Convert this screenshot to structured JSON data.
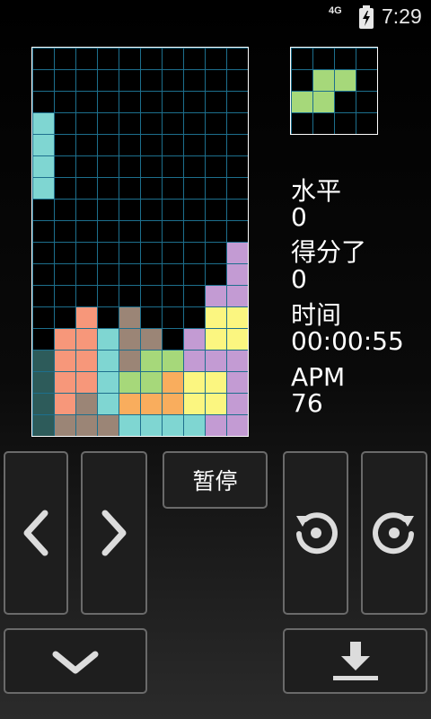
{
  "status_bar": {
    "network": "4G",
    "time": "7:29"
  },
  "stats": {
    "level_label": "水平",
    "level_value": "0",
    "score_label": "得分了",
    "score_value": "0",
    "time_label": "时间",
    "time_value": "00:00:55",
    "apm_label": "APM",
    "apm_value": "76"
  },
  "controls": {
    "pause_label": "暂停",
    "left_icon": "chevron-left-icon",
    "right_icon": "chevron-right-icon",
    "rotate_ccw_icon": "rotate-ccw-icon",
    "rotate_cw_icon": "rotate-cw-icon",
    "soft_drop_icon": "chevron-down-icon",
    "hard_drop_icon": "hard-drop-icon"
  },
  "colors": {
    "grid_line": "#1d6f8d",
    "cyan": "#7fd6d2",
    "dark_teal": "#2d5b5a",
    "salmon": "#f7977a",
    "brown": "#9b8576",
    "green": "#a6d87a",
    "orange": "#f9ad5d",
    "yellow": "#fbf680",
    "purple": "#c39bd3"
  },
  "board": {
    "columns": 10,
    "rows": 18,
    "cells": [
      [
        0,
        3,
        "cyan"
      ],
      [
        0,
        4,
        "cyan"
      ],
      [
        0,
        5,
        "cyan"
      ],
      [
        0,
        6,
        "cyan"
      ],
      [
        9,
        9,
        "purple"
      ],
      [
        9,
        10,
        "purple"
      ],
      [
        8,
        11,
        "purple"
      ],
      [
        9,
        11,
        "purple"
      ],
      [
        2,
        12,
        "salmon"
      ],
      [
        4,
        12,
        "brown"
      ],
      [
        8,
        12,
        "yellow"
      ],
      [
        9,
        12,
        "yellow"
      ],
      [
        1,
        13,
        "salmon"
      ],
      [
        2,
        13,
        "salmon"
      ],
      [
        3,
        13,
        "cyan"
      ],
      [
        4,
        13,
        "brown"
      ],
      [
        5,
        13,
        "brown"
      ],
      [
        7,
        13,
        "purple"
      ],
      [
        8,
        13,
        "yellow"
      ],
      [
        9,
        13,
        "yellow"
      ],
      [
        0,
        14,
        "dark_teal"
      ],
      [
        1,
        14,
        "salmon"
      ],
      [
        2,
        14,
        "salmon"
      ],
      [
        3,
        14,
        "cyan"
      ],
      [
        4,
        14,
        "brown"
      ],
      [
        5,
        14,
        "green"
      ],
      [
        6,
        14,
        "green"
      ],
      [
        7,
        14,
        "purple"
      ],
      [
        8,
        14,
        "purple"
      ],
      [
        9,
        14,
        "purple"
      ],
      [
        0,
        15,
        "dark_teal"
      ],
      [
        1,
        15,
        "salmon"
      ],
      [
        2,
        15,
        "salmon"
      ],
      [
        3,
        15,
        "cyan"
      ],
      [
        4,
        15,
        "green"
      ],
      [
        5,
        15,
        "green"
      ],
      [
        6,
        15,
        "orange"
      ],
      [
        7,
        15,
        "yellow"
      ],
      [
        8,
        15,
        "yellow"
      ],
      [
        9,
        15,
        "purple"
      ],
      [
        0,
        16,
        "dark_teal"
      ],
      [
        1,
        16,
        "salmon"
      ],
      [
        2,
        16,
        "brown"
      ],
      [
        3,
        16,
        "cyan"
      ],
      [
        4,
        16,
        "orange"
      ],
      [
        5,
        16,
        "orange"
      ],
      [
        6,
        16,
        "orange"
      ],
      [
        7,
        16,
        "yellow"
      ],
      [
        8,
        16,
        "yellow"
      ],
      [
        9,
        16,
        "purple"
      ],
      [
        0,
        17,
        "dark_teal"
      ],
      [
        1,
        17,
        "brown"
      ],
      [
        2,
        17,
        "brown"
      ],
      [
        3,
        17,
        "brown"
      ],
      [
        4,
        17,
        "cyan"
      ],
      [
        5,
        17,
        "cyan"
      ],
      [
        6,
        17,
        "cyan"
      ],
      [
        7,
        17,
        "cyan"
      ],
      [
        8,
        17,
        "purple"
      ],
      [
        9,
        17,
        "purple"
      ]
    ]
  },
  "next_piece": {
    "columns": 4,
    "rows": 4,
    "cells": [
      [
        1,
        1,
        "green"
      ],
      [
        2,
        1,
        "green"
      ],
      [
        0,
        2,
        "green"
      ],
      [
        1,
        2,
        "green"
      ]
    ]
  }
}
